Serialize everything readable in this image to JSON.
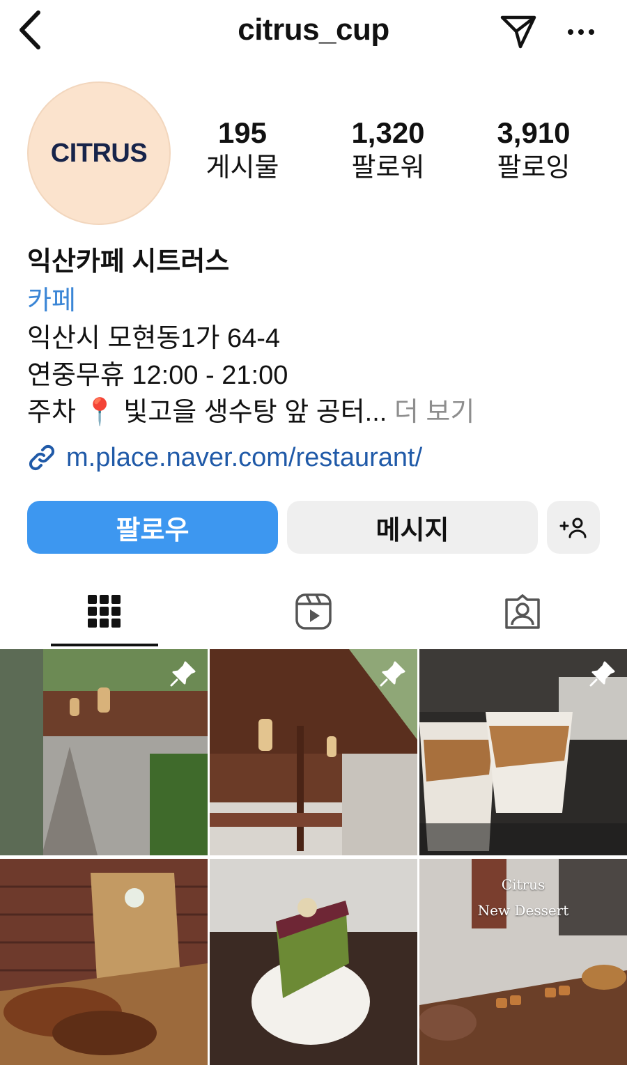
{
  "header": {
    "username": "citrus_cup",
    "back_icon": "chevron-left-icon",
    "send_icon": "paper-plane-icon",
    "more_icon": "more-horizontal-icon"
  },
  "profile": {
    "avatar_text": "CITRUS",
    "avatar_bg": "#fbe3cd",
    "stats": {
      "posts": {
        "value": "195",
        "label": "게시물"
      },
      "followers": {
        "value": "1,320",
        "label": "팔로워"
      },
      "following": {
        "value": "3,910",
        "label": "팔로잉"
      }
    }
  },
  "bio": {
    "name": "익산카페 시트러스",
    "category": "카페",
    "address": "익산시 모현동1가 64-4",
    "hours": "연중무휴 12:00 - 21:00",
    "parking": "주차 📍 빛고을 생수탕 앞 공터...",
    "more": "더 보기",
    "link": "m.place.naver.com/restaurant/"
  },
  "actions": {
    "follow": "팔로우",
    "message": "메시지",
    "add_person_icon": "add-person-icon"
  },
  "colors": {
    "accent": "#3d97f0",
    "link": "#205aa8",
    "category": "#3b86d6"
  },
  "tabs": [
    {
      "icon": "grid-icon",
      "active": true
    },
    {
      "icon": "reels-icon",
      "active": false
    },
    {
      "icon": "tagged-icon",
      "active": false
    }
  ],
  "posts": [
    {
      "subject": "garden courtyard",
      "pinned": true
    },
    {
      "subject": "wooden building with lanterns",
      "pinned": true
    },
    {
      "subject": "iced coffee drinks",
      "pinned": true
    },
    {
      "subject": "taiyaki pastries",
      "pinned": false
    },
    {
      "subject": "matcha cake slice",
      "pinned": false
    },
    {
      "subject": "dessert display",
      "pinned": false,
      "overlay_line1": "Citrus",
      "overlay_line2": "New Dessert"
    }
  ]
}
